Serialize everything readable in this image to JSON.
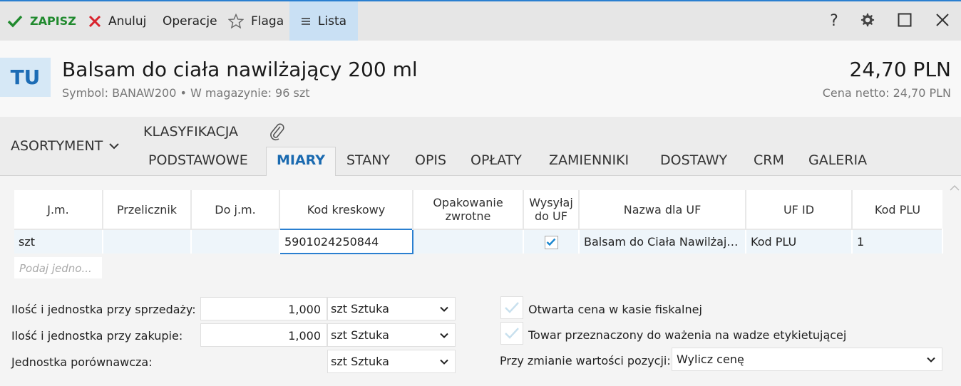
{
  "toolbar": {
    "save_label": "ZAPISZ",
    "cancel_label": "Anuluj",
    "operations_label": "Operacje",
    "flag_label": "Flaga",
    "list_label": "Lista",
    "help_label": "?"
  },
  "header": {
    "badge": "TU",
    "title": "Balsam do ciała nawilżający 200 ml",
    "subtitle": "Symbol: BANAW200  •  W magazynie: 96 szt",
    "price": "24,70 PLN",
    "netto": "Cena netto: 24,70 PLN"
  },
  "nav": {
    "assortment": "ASORTYMENT",
    "classification": "KLASYFIKACJA",
    "tabs": [
      "PODSTAWOWE",
      "MIARY",
      "STANY",
      "OPIS",
      "OPŁATY",
      "ZAMIENNIKI",
      "DOSTAWY",
      "CRM",
      "GALERIA"
    ],
    "active_tab": "MIARY"
  },
  "grid": {
    "columns": [
      "J.m.",
      "Przelicznik",
      "Do j.m.",
      "Kod kreskowy",
      "Opakowanie zwrotne",
      "Wysyłaj do UF",
      "Nazwa dla UF",
      "UF ID",
      "Kod PLU"
    ],
    "rows": [
      {
        "unit": "szt",
        "factor": "",
        "to_unit": "",
        "barcode": "5901024250844",
        "returnable": "",
        "send_uf": true,
        "uf_name": "Balsam do Ciała Nawilżaj…",
        "uf_id": "Kod PLU",
        "plu": "1"
      }
    ],
    "new_row_placeholder": "Podaj jedno..."
  },
  "form": {
    "sale_label": "Ilość i jednostka przy sprzedaży:",
    "sale_qty": "1,000",
    "sale_unit": "szt",
    "sale_unit_name": "Sztuka",
    "purchase_label": "Ilość i jednostka przy zakupie:",
    "purchase_qty": "1,000",
    "purchase_unit": "szt",
    "purchase_unit_name": "Sztuka",
    "compare_label": "Jednostka porównawcza:",
    "compare_unit": "szt",
    "compare_unit_name": "Sztuka",
    "open_price_label": "Otwarta cena w kasie fiskalnej",
    "open_price_checked": false,
    "weighing_label": "Towar przeznaczony do ważenia na wadze etykietującej",
    "weighing_checked": false,
    "value_change_label": "Przy zmianie wartości pozycji:",
    "value_change_option": "Wylicz cenę"
  },
  "colors": {
    "accent": "#2a7fd0",
    "save_green": "#208a2e",
    "cancel_red": "#d9232d",
    "list_tab_bg": "#c9e0f4"
  }
}
